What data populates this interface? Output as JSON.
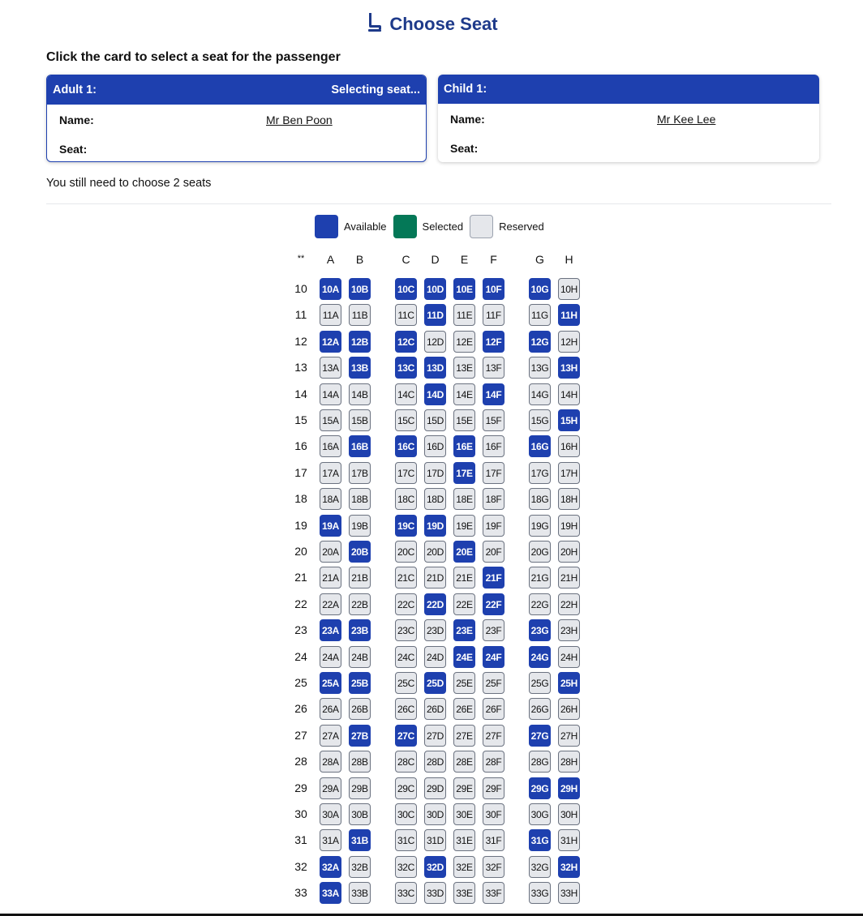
{
  "header": {
    "title": "Choose Seat",
    "icon": "seat-icon"
  },
  "instruction": "Click the card to select a seat for the passenger",
  "passengers": [
    {
      "type": "Adult 1:",
      "status": "Selecting seat...",
      "name_label": "Name:",
      "name": "Mr Ben Poon",
      "seat_label": "Seat:",
      "seat": "",
      "active": true
    },
    {
      "type": "Child 1:",
      "status": "",
      "name_label": "Name:",
      "name": "Mr Kee Lee",
      "seat_label": "Seat:",
      "seat": "",
      "active": false
    }
  ],
  "remaining_text": "You still need to choose 2 seats",
  "legend": {
    "available": "Available",
    "selected": "Selected",
    "reserved": "Reserved"
  },
  "colors": {
    "available": "#1e40af",
    "selected": "#047857",
    "reserved": "#e5e7eb"
  },
  "seat_map": {
    "corner": "**",
    "columns": [
      "A",
      "B",
      "C",
      "D",
      "E",
      "F",
      "G",
      "H"
    ],
    "rows": [
      {
        "row": "10",
        "available": [
          "A",
          "B",
          "C",
          "D",
          "E",
          "F",
          "G"
        ]
      },
      {
        "row": "11",
        "available": [
          "D",
          "H"
        ]
      },
      {
        "row": "12",
        "available": [
          "A",
          "B",
          "C",
          "F",
          "G"
        ]
      },
      {
        "row": "13",
        "available": [
          "B",
          "C",
          "D",
          "H"
        ]
      },
      {
        "row": "14",
        "available": [
          "D",
          "F"
        ]
      },
      {
        "row": "15",
        "available": [
          "H"
        ]
      },
      {
        "row": "16",
        "available": [
          "B",
          "C",
          "E",
          "G"
        ]
      },
      {
        "row": "17",
        "available": [
          "E"
        ]
      },
      {
        "row": "18",
        "available": []
      },
      {
        "row": "19",
        "available": [
          "A",
          "C",
          "D"
        ]
      },
      {
        "row": "20",
        "available": [
          "B",
          "E"
        ]
      },
      {
        "row": "21",
        "available": [
          "F"
        ]
      },
      {
        "row": "22",
        "available": [
          "D",
          "F"
        ]
      },
      {
        "row": "23",
        "available": [
          "A",
          "B",
          "E",
          "G"
        ]
      },
      {
        "row": "24",
        "available": [
          "E",
          "F",
          "G"
        ]
      },
      {
        "row": "25",
        "available": [
          "A",
          "B",
          "D",
          "H"
        ]
      },
      {
        "row": "26",
        "available": []
      },
      {
        "row": "27",
        "available": [
          "B",
          "C",
          "G"
        ]
      },
      {
        "row": "28",
        "available": []
      },
      {
        "row": "29",
        "available": [
          "G",
          "H"
        ]
      },
      {
        "row": "30",
        "available": []
      },
      {
        "row": "31",
        "available": [
          "B",
          "G"
        ]
      },
      {
        "row": "32",
        "available": [
          "A",
          "D",
          "H"
        ]
      },
      {
        "row": "33",
        "available": [
          "A"
        ]
      }
    ]
  }
}
